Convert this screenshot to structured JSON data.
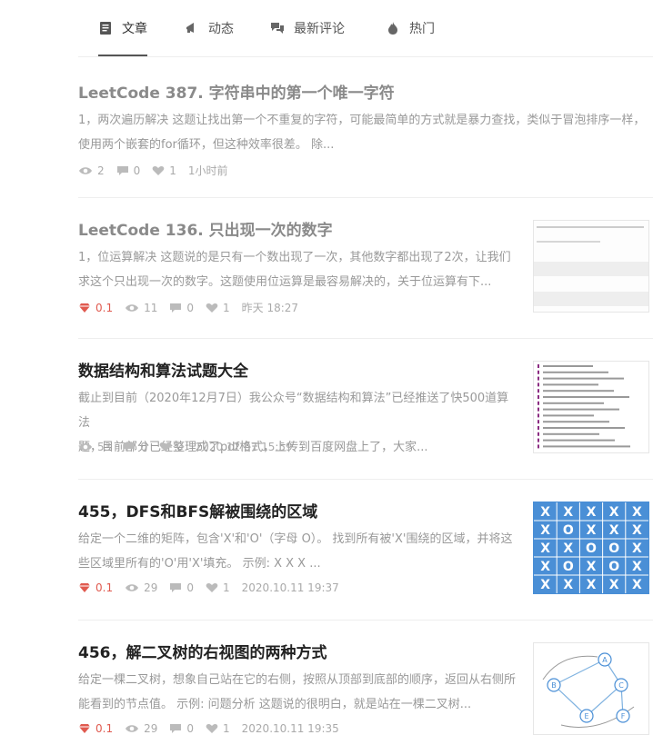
{
  "tabs": [
    {
      "label": "文章",
      "icon": "document-icon"
    },
    {
      "label": "动态",
      "icon": "megaphone-icon"
    },
    {
      "label": "最新评论",
      "icon": "comments-icon"
    },
    {
      "label": "热门",
      "icon": "flame-icon"
    }
  ],
  "articles": [
    {
      "title": "LeetCode 387. 字符串中的第一个唯一字符",
      "summary_line1": "1，两次遍历解决 这题让找出第一个不重复的字符，可能最简单的方式就是暴力查找，类似于冒泡排序一样，",
      "summary_line2": "使用两个嵌套的for循环，但这种效率很差。 除...",
      "views": "2",
      "comments": "0",
      "likes": "1",
      "time": "1小时前"
    },
    {
      "title": "LeetCode 136. 只出现一次的数字",
      "summary_line1": "1，位运算解决 这题说的是只有一个数出现了一次，其他数字都出现了2次，让我们",
      "summary_line2": "求这个只出现一次的数字。这题使用位运算是最容易解决的，关于位运算有下...",
      "coins": "0.1",
      "views": "11",
      "comments": "0",
      "likes": "1",
      "time": "昨天 18:27"
    },
    {
      "title": "数据结构和算法试题大全",
      "summary_line1": "截止到目前（2020年12月7日）我公众号“数据结构和算法”已经推送了快500道算法",
      "summary_line2": "题，目前部分已经整理成了pdf格式，上传到百度网盘上了，大家...",
      "views": "53",
      "comments": "0",
      "likes": "0",
      "time": "2020.12.07 15:59"
    },
    {
      "title": "455，DFS和BFS解被围绕的区域",
      "summary_line1": "给定一个二维的矩阵，包含'X'和'O'（字母 O）。 找到所有被'X'围绕的区域，并将这",
      "summary_line2": "些区域里所有的'O'用'X'填充。 示例: X X X ...",
      "coins": "0.1",
      "views": "29",
      "comments": "0",
      "likes": "1",
      "time": "2020.10.11 19:37",
      "grid": [
        [
          "X",
          "X",
          "X",
          "X",
          "X"
        ],
        [
          "X",
          "O",
          "X",
          "X",
          "X"
        ],
        [
          "X",
          "X",
          "O",
          "O",
          "X"
        ],
        [
          "X",
          "O",
          "X",
          "O",
          "X"
        ],
        [
          "X",
          "X",
          "X",
          "X",
          "X"
        ]
      ]
    },
    {
      "title": "456，解二叉树的右视图的两种方式",
      "summary_line1": "给定一棵二叉树，想象自己站在它的右侧，按照从顶部到底部的顺序，返回从右侧所",
      "summary_line2": "能看到的节点值。 示例: 问题分析 这题说的很明白，就是站在一棵二叉树...",
      "coins": "0.1",
      "views": "29",
      "comments": "0",
      "likes": "1",
      "time": "2020.10.11 19:35",
      "tree_nodes": [
        "A",
        "B",
        "C",
        "E",
        "F"
      ]
    }
  ],
  "colors": {
    "coin": "#e05a4f",
    "grid_bg": "#4a8fd6",
    "meta": "#aaaaaa"
  }
}
